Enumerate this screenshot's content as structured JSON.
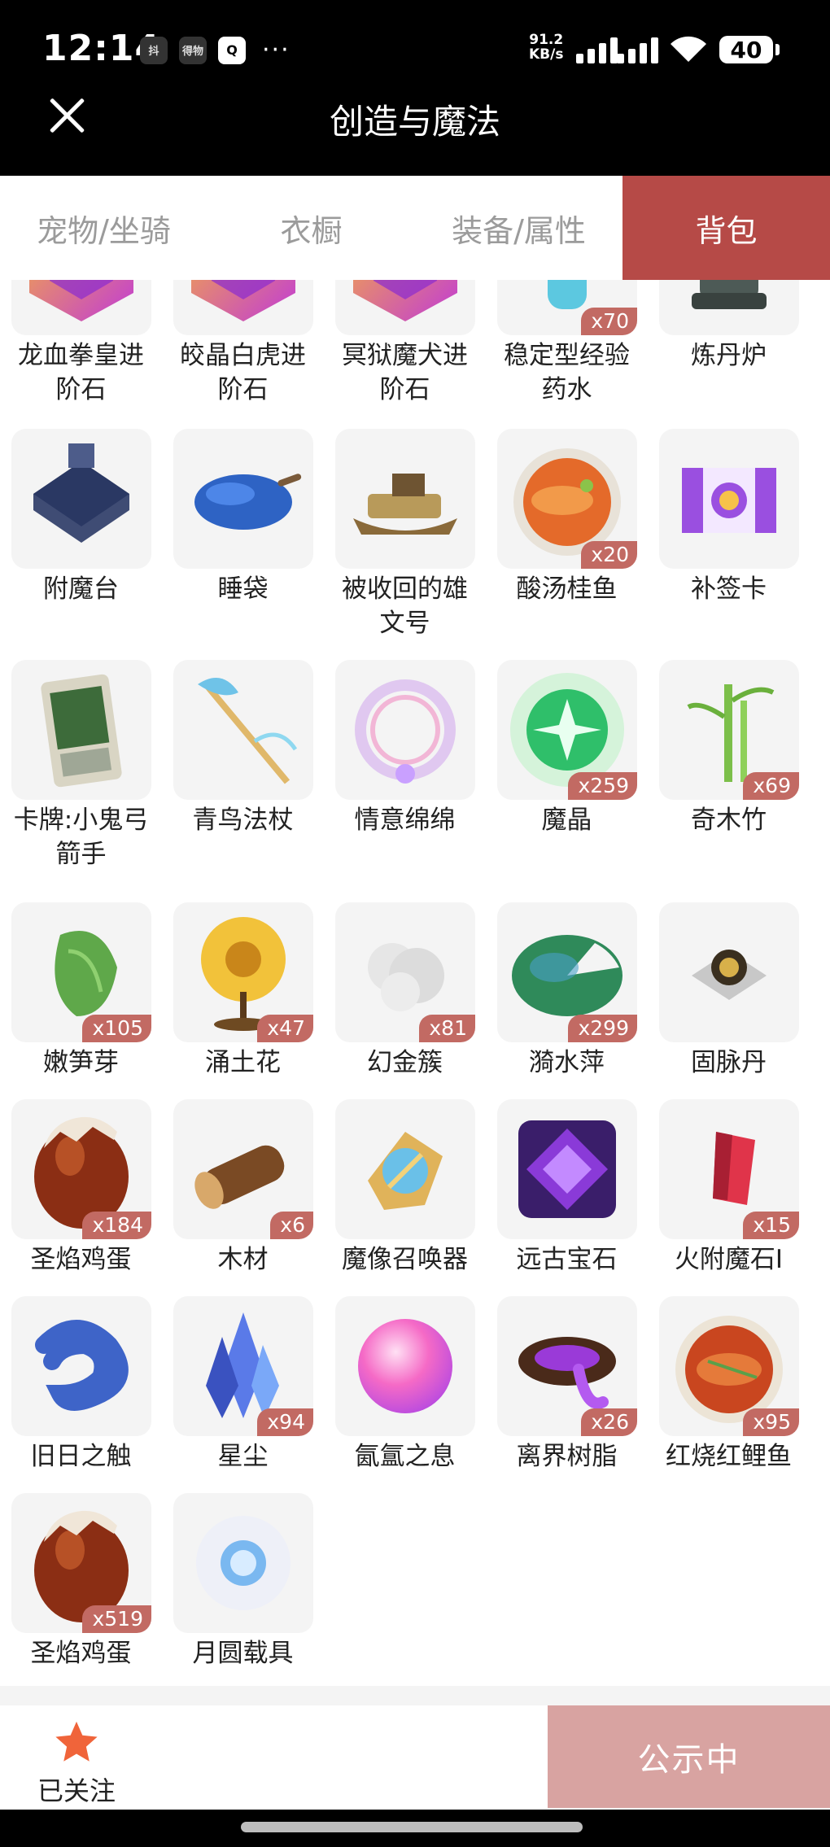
{
  "status_bar": {
    "time": "12:14",
    "app_badge_1": "抖",
    "app_badge_2": "得物",
    "app_badge_3": "Q",
    "more": "···",
    "net_speed": "91.2",
    "net_unit": "KB/s",
    "battery": "40"
  },
  "header": {
    "title": "创造与魔法"
  },
  "tabs": [
    {
      "label": "宠物/坐骑",
      "active": false
    },
    {
      "label": "衣橱",
      "active": false
    },
    {
      "label": "装备/属性",
      "active": false
    },
    {
      "label": "背包",
      "active": true
    }
  ],
  "items": [
    {
      "name": "龙血拳皇进阶石",
      "line1": "龙血拳皇进",
      "line2": "阶石",
      "qty": "",
      "icon": "gem-icon"
    },
    {
      "name": "皎晶白虎进阶石",
      "line1": "皎晶白虎进",
      "line2": "阶石",
      "qty": "",
      "icon": "gem-icon"
    },
    {
      "name": "冥狱魔犬进阶石",
      "line1": "冥狱魔犬进",
      "line2": "阶石",
      "qty": "",
      "icon": "gem-icon"
    },
    {
      "name": "稳定型经验药水",
      "line1": "稳定型经验",
      "line2": "药水",
      "qty": "x70",
      "icon": "potion-icon"
    },
    {
      "name": "炼丹炉",
      "line1": "炼丹炉",
      "line2": "",
      "qty": "",
      "icon": "furnace-icon"
    },
    {
      "name": "附魔台",
      "line1": "附魔台",
      "line2": "",
      "qty": "",
      "icon": "enchant-table-icon"
    },
    {
      "name": "睡袋",
      "line1": "睡袋",
      "line2": "",
      "qty": "",
      "icon": "sleeping-bag-icon"
    },
    {
      "name": "被收回的雄文号",
      "line1": "被收回的雄",
      "line2": "文号",
      "qty": "",
      "icon": "ship-icon"
    },
    {
      "name": "酸汤桂鱼",
      "line1": "酸汤桂鱼",
      "line2": "",
      "qty": "x20",
      "icon": "fish-dish-icon"
    },
    {
      "name": "补签卡",
      "line1": "补签卡",
      "line2": "",
      "qty": "",
      "icon": "ticket-icon"
    },
    {
      "name": "卡牌:小鬼弓箭手",
      "line1": "卡牌:小鬼弓",
      "line2": "箭手",
      "qty": "",
      "icon": "card-icon"
    },
    {
      "name": "青鸟法杖",
      "line1": "青鸟法杖",
      "line2": "",
      "qty": "",
      "icon": "staff-icon"
    },
    {
      "name": "情意绵绵",
      "line1": "情意绵绵",
      "line2": "",
      "qty": "",
      "icon": "wreath-icon"
    },
    {
      "name": "魔晶",
      "line1": "魔晶",
      "line2": "",
      "qty": "x259",
      "icon": "crystal-orb-icon"
    },
    {
      "name": "奇木竹",
      "line1": "奇木竹",
      "line2": "",
      "qty": "x69",
      "icon": "bamboo-icon"
    },
    {
      "name": "嫩笋芽",
      "line1": "嫩笋芽",
      "line2": "",
      "qty": "x105",
      "icon": "sprout-icon"
    },
    {
      "name": "涌土花",
      "line1": "涌土花",
      "line2": "",
      "qty": "x47",
      "icon": "flower-icon"
    },
    {
      "name": "幻金簇",
      "line1": "幻金簇",
      "line2": "",
      "qty": "x81",
      "icon": "cluster-icon"
    },
    {
      "name": "漪水萍",
      "line1": "漪水萍",
      "line2": "",
      "qty": "x299",
      "icon": "lilypad-icon"
    },
    {
      "name": "固脉丹",
      "line1": "固脉丹",
      "line2": "",
      "qty": "",
      "icon": "pill-icon"
    },
    {
      "name": "圣焰鸡蛋",
      "line1": "圣焰鸡蛋",
      "line2": "",
      "qty": "x184",
      "icon": "egg-icon"
    },
    {
      "name": "木材",
      "line1": "木材",
      "line2": "",
      "qty": "x6",
      "icon": "log-icon"
    },
    {
      "name": "魔像召唤器",
      "line1": "魔像召唤器",
      "line2": "",
      "qty": "",
      "icon": "summoner-icon"
    },
    {
      "name": "远古宝石",
      "line1": "远古宝石",
      "line2": "",
      "qty": "",
      "icon": "ancient-gem-icon"
    },
    {
      "name": "火附魔石I",
      "line1": "火附魔石I",
      "line2": "",
      "qty": "x15",
      "icon": "fire-stone-icon"
    },
    {
      "name": "旧日之触",
      "line1": "旧日之触",
      "line2": "",
      "qty": "",
      "icon": "tentacle-icon"
    },
    {
      "name": "星尘",
      "line1": "星尘",
      "line2": "",
      "qty": "x94",
      "icon": "stardust-icon"
    },
    {
      "name": "氤氲之息",
      "line1": "氤氲之息",
      "line2": "",
      "qty": "",
      "icon": "pink-orb-icon"
    },
    {
      "name": "离界树脂",
      "line1": "离界树脂",
      "line2": "",
      "qty": "x26",
      "icon": "resin-icon"
    },
    {
      "name": "红烧红鲤鱼",
      "line1": "红烧红鲤鱼",
      "line2": "",
      "qty": "x95",
      "icon": "carp-dish-icon"
    },
    {
      "name": "圣焰鸡蛋",
      "line1": "圣焰鸡蛋",
      "line2": "",
      "qty": "x519",
      "icon": "egg-icon"
    },
    {
      "name": "月圆载具",
      "line1": "月圆载具",
      "line2": "",
      "qty": "",
      "icon": "moon-vehicle-icon"
    }
  ],
  "bottom_bar": {
    "follow_label": "已关注",
    "publish_label": "公示中"
  },
  "colors": {
    "accent": "#b64a47",
    "badge": "#c26a63",
    "publish_button": "#d8a3a1",
    "follow_star": "#f0643a"
  }
}
